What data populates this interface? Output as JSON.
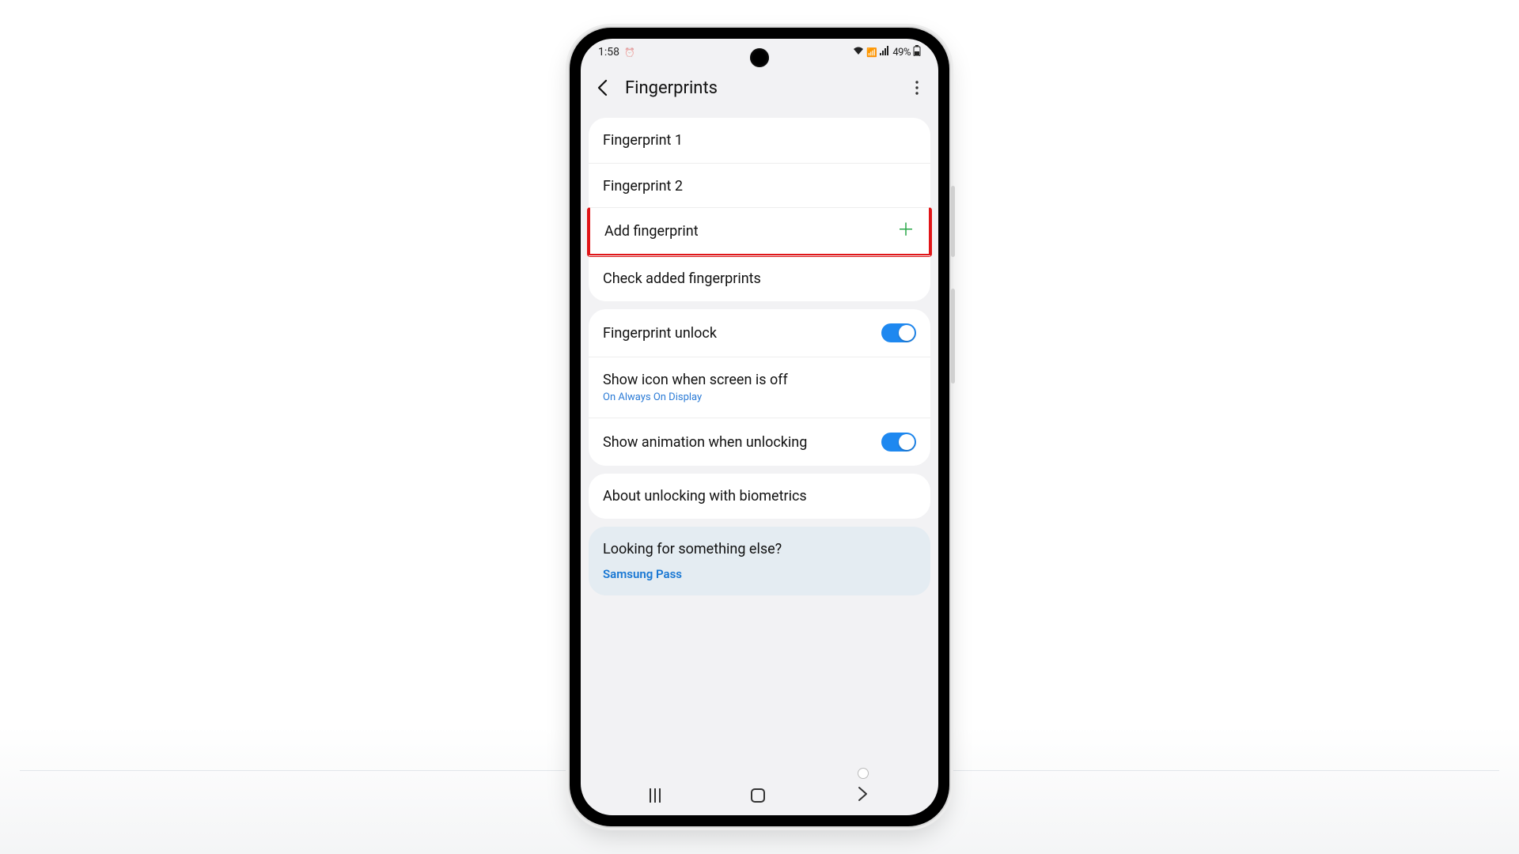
{
  "status": {
    "time": "1:58",
    "battery": "49%"
  },
  "topbar": {
    "title": "Fingerprints"
  },
  "card1": {
    "fp1": "Fingerprint 1",
    "fp2": "Fingerprint 2",
    "add": "Add fingerprint",
    "check": "Check added fingerprints"
  },
  "card2": {
    "unlock": "Fingerprint unlock",
    "showIcon": "Show icon when screen is off",
    "showIconSub": "On Always On Display",
    "showAnim": "Show animation when unlocking"
  },
  "card3": {
    "about": "About unlocking with biometrics"
  },
  "suggest": {
    "q": "Looking for something else?",
    "link": "Samsung Pass"
  }
}
